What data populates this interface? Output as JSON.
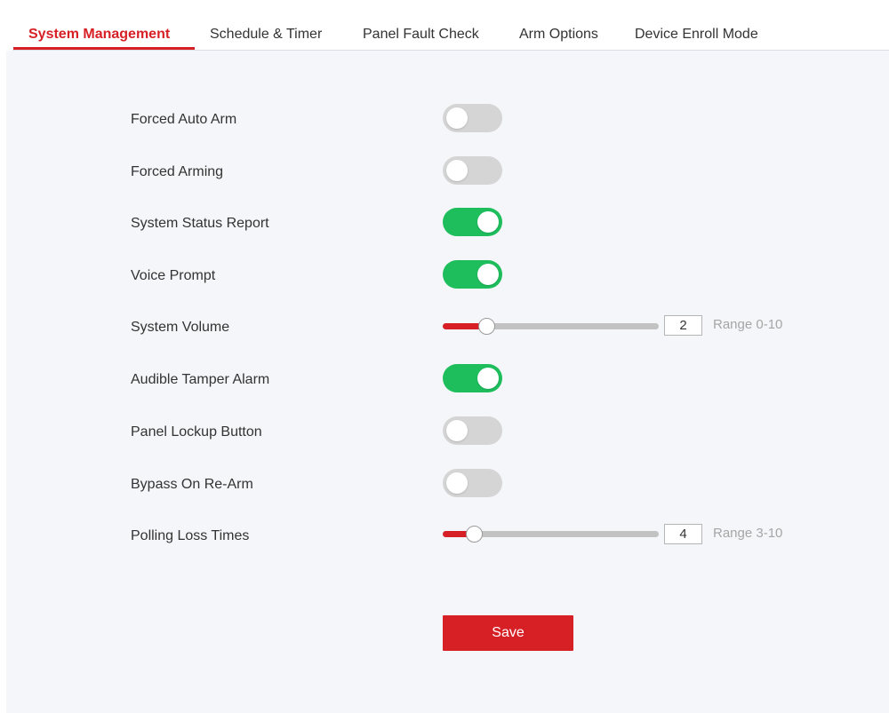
{
  "tabs": [
    {
      "label": "System Management",
      "active": true
    },
    {
      "label": "Schedule & Timer",
      "active": false
    },
    {
      "label": "Panel Fault Check",
      "active": false
    },
    {
      "label": "Arm Options",
      "active": false
    },
    {
      "label": "Device Enroll Mode",
      "active": false
    }
  ],
  "settings": {
    "forced_auto_arm": {
      "label": "Forced Auto Arm",
      "on": false
    },
    "forced_arming": {
      "label": "Forced Arming",
      "on": false
    },
    "system_status_report": {
      "label": "System Status Report",
      "on": true
    },
    "voice_prompt": {
      "label": "Voice Prompt",
      "on": true
    },
    "system_volume": {
      "label": "System Volume",
      "value": "2",
      "min": 0,
      "max": 10,
      "range_text": "Range 0-10"
    },
    "audible_tamper_alarm": {
      "label": "Audible Tamper Alarm",
      "on": true
    },
    "panel_lockup_button": {
      "label": "Panel Lockup Button",
      "on": false
    },
    "bypass_on_rearm": {
      "label": "Bypass On Re-Arm",
      "on": false
    },
    "polling_loss_times": {
      "label": "Polling Loss Times",
      "value": "4",
      "min": 3,
      "max": 10,
      "range_text": "Range 3-10"
    }
  },
  "save_label": "Save",
  "colors": {
    "accent": "#d71f26",
    "switch_on": "#1ebe5d",
    "switch_off": "#d5d5d5",
    "panel_bg": "#f5f6f9"
  }
}
